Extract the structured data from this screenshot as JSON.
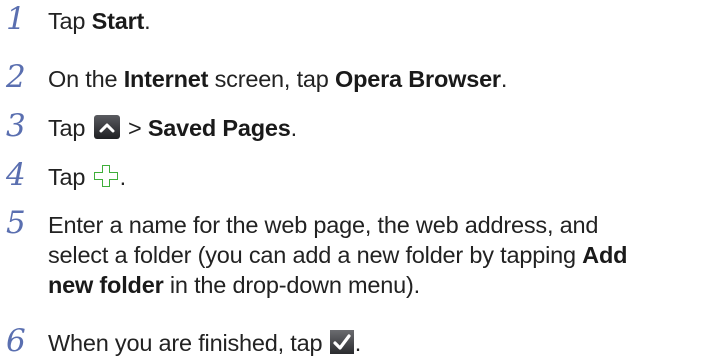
{
  "steps": [
    {
      "number": "1",
      "parts": [
        "Tap ",
        "Start",
        "."
      ]
    },
    {
      "number": "2",
      "parts": [
        "On the ",
        "Internet",
        " screen, tap ",
        "Opera Browser",
        "."
      ]
    },
    {
      "number": "3",
      "parts": [
        "Tap ",
        " > ",
        "Saved Pages",
        "."
      ],
      "icon": "chevron-up-icon"
    },
    {
      "number": "4",
      "parts": [
        "Tap ",
        "."
      ],
      "icon": "plus-icon"
    },
    {
      "number": "5",
      "lines": [
        "Enter a name for the web page, the web address, and",
        "select a folder (you can add a new folder by tapping "
      ],
      "bold_1": "Add",
      "bold_2": "new folder",
      "tail": " in the drop-down menu)."
    },
    {
      "number": "6",
      "parts": [
        "When you are finished, tap ",
        "."
      ],
      "icon": "checkmark-icon"
    }
  ],
  "colors": {
    "step_number": "#5a6fb0",
    "text": "#222222"
  }
}
